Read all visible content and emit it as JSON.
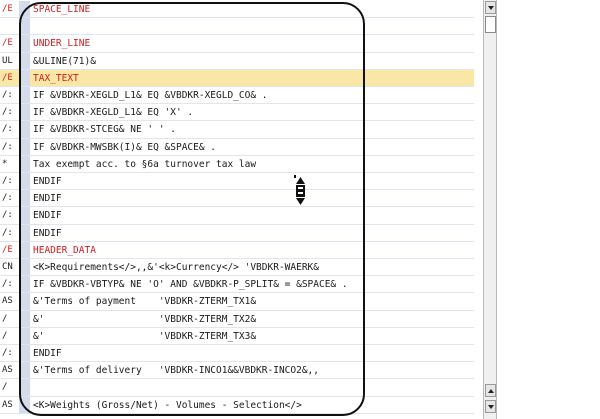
{
  "editor": {
    "lines": [
      {
        "fmt": "/E",
        "text": "SPACE_LINE",
        "red": true,
        "hl": false
      },
      {
        "fmt": "",
        "text": "",
        "red": false,
        "hl": false
      },
      {
        "fmt": "/E",
        "text": "UNDER_LINE",
        "red": true,
        "hl": false
      },
      {
        "fmt": "UL",
        "text": "&ULINE(71)&",
        "red": false,
        "hl": false
      },
      {
        "fmt": "/E",
        "text": "TAX_TEXT",
        "red": true,
        "hl": true
      },
      {
        "fmt": "/:",
        "text": "IF &VBDKR-XEGLD_L1& EQ &VBDKR-XEGLD_CO& .",
        "red": false,
        "hl": false
      },
      {
        "fmt": "/:",
        "text": "IF &VBDKR-XEGLD_L1& EQ 'X' .",
        "red": false,
        "hl": false
      },
      {
        "fmt": "/:",
        "text": "IF &VBDKR-STCEG& NE ' ' .",
        "red": false,
        "hl": false
      },
      {
        "fmt": "/:",
        "text": "IF &VBDKR-MWSBK(I)& EQ &SPACE& .",
        "red": false,
        "hl": false
      },
      {
        "fmt": "*",
        "text": "Tax exempt acc. to §6a turnover tax law",
        "red": false,
        "hl": false
      },
      {
        "fmt": "/:",
        "text": "ENDIF",
        "red": false,
        "hl": false
      },
      {
        "fmt": "/:",
        "text": "ENDIF",
        "red": false,
        "hl": false
      },
      {
        "fmt": "/:",
        "text": "ENDIF",
        "red": false,
        "hl": false
      },
      {
        "fmt": "/:",
        "text": "ENDIF",
        "red": false,
        "hl": false
      },
      {
        "fmt": "/E",
        "text": "HEADER_DATA",
        "red": true,
        "hl": false
      },
      {
        "fmt": "CN",
        "text": "<K>Requirements</>,,&'<k>Currency</> 'VBDKR-WAERK&",
        "red": false,
        "hl": false
      },
      {
        "fmt": "/:",
        "text": "IF &VBDKR-VBTYP& NE 'O' AND &VBDKR-P_SPLIT& = &SPACE& .",
        "red": false,
        "hl": false
      },
      {
        "fmt": "AS",
        "text": "&'Terms of payment    'VBDKR-ZTERM_TX1&",
        "red": false,
        "hl": false
      },
      {
        "fmt": "/",
        "text": "&'                    'VBDKR-ZTERM_TX2&",
        "red": false,
        "hl": false
      },
      {
        "fmt": "/",
        "text": "&'                    'VBDKR-ZTERM_TX3&",
        "red": false,
        "hl": false
      },
      {
        "fmt": "/:",
        "text": "ENDIF",
        "red": false,
        "hl": false
      },
      {
        "fmt": "AS",
        "text": "&'Terms of delivery   'VBDKR-INCO1&&VBDKR-INCO2&,,",
        "red": false,
        "hl": false
      },
      {
        "fmt": "/",
        "text": "",
        "red": false,
        "hl": false
      },
      {
        "fmt": "AS",
        "text": "<K>Weights (Gross/Net) - Volumes - Selection</>",
        "red": false,
        "hl": false
      }
    ]
  },
  "scrollbar": {
    "up_icon": "arrow-up-icon",
    "down_icon": "arrow-down-icon"
  },
  "cursor": {
    "icon": "resize-vertical-cursor-icon"
  }
}
